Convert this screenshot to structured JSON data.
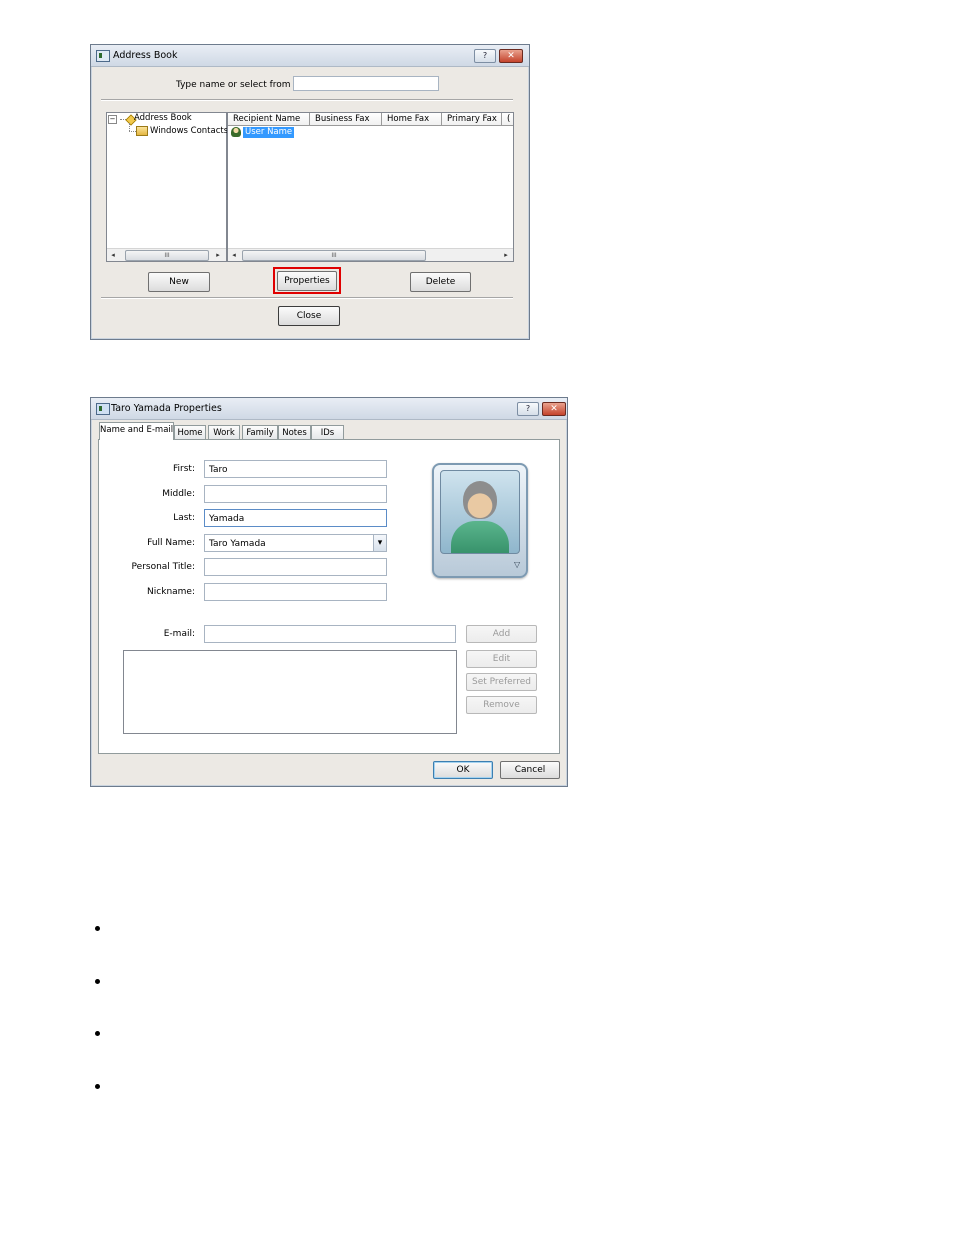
{
  "address_book": {
    "title": "Address Book",
    "help_glyph": "?",
    "close_glyph": "✕",
    "search_label": "Type name or select from list:",
    "search_value": "",
    "tree": {
      "root": "Address Book",
      "child": "Windows Contacts",
      "expander": "−"
    },
    "columns": [
      "Recipient Name",
      "Business Fax",
      "Home Fax",
      "Primary Fax",
      "("
    ],
    "rows": [
      {
        "name": "User Name"
      }
    ],
    "scroll_grip": "III",
    "buttons": {
      "new": "New",
      "properties": "Properties",
      "delete": "Delete",
      "close": "Close"
    },
    "highlight_color": "#e00000",
    "selection_color": "#3399ff"
  },
  "properties": {
    "title": "Taro Yamada Properties",
    "help_glyph": "?",
    "close_glyph": "✕",
    "tabs": [
      "Name and E-mail",
      "Home",
      "Work",
      "Family",
      "Notes",
      "IDs"
    ],
    "active_tab": "Name and E-mail",
    "fields": {
      "first_label": "First:",
      "first_value": "Taro",
      "middle_label": "Middle:",
      "middle_value": "",
      "last_label": "Last:",
      "last_value": "Yamada",
      "full_name_label": "Full Name:",
      "full_name_value": "Taro Yamada",
      "personal_title_label": "Personal Title:",
      "personal_title_value": "",
      "nickname_label": "Nickname:",
      "nickname_value": "",
      "email_label": "E-mail:",
      "email_value": ""
    },
    "email_buttons": {
      "add": "Add",
      "edit": "Edit",
      "set_preferred": "Set Preferred",
      "remove": "Remove"
    },
    "dropdown_glyph": "▾",
    "avatar_icon": "contact-silhouette-icon",
    "footer": {
      "ok": "OK",
      "cancel": "Cancel"
    }
  }
}
